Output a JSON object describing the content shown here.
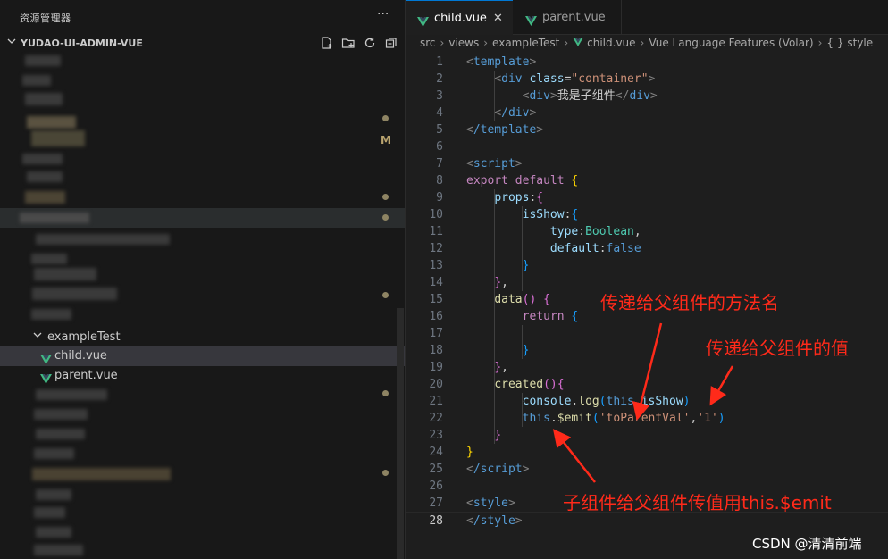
{
  "sidebar": {
    "title": "资源管理器",
    "more": "···",
    "project": "YUDAO-UI-ADMIN-VUE",
    "m_flag": "M",
    "folder": "exampleTest",
    "files": [
      "child.vue",
      "parent.vue"
    ]
  },
  "tabs": [
    {
      "label": "child.vue",
      "close": "✕"
    },
    {
      "label": "parent.vue"
    }
  ],
  "breadcrumb": [
    "src",
    "views",
    "exampleTest",
    "child.vue",
    "Vue Language Features (Volar)",
    "{ } style"
  ],
  "code": {
    "line_numbers": [
      "1",
      "2",
      "3",
      "4",
      "5",
      "6",
      "7",
      "8",
      "9",
      "10",
      "11",
      "12",
      "13",
      "14",
      "15",
      "16",
      "17",
      "18",
      "19",
      "20",
      "21",
      "22",
      "23",
      "24",
      "25",
      "26",
      "27",
      "28"
    ],
    "l1_tag": "template",
    "l2_tag": "div",
    "l2_attr": "class",
    "l2_eq": "=",
    "l2_val": "\"container\"",
    "l3_tag": "div",
    "l3_text": "我是子组件",
    "l4_tag": "/div",
    "l5_tag": "/template",
    "l7_tag": "script",
    "l8_kw1": "export",
    "l8_kw2": "default",
    "l9_prop": "props",
    "l10_prop": "isShow",
    "l11_prop": "type",
    "l11_type": "Boolean",
    "l12_prop": "default",
    "l12_val": "false",
    "l15_fn": "data",
    "l16_kw": "return",
    "l20_fn": "created",
    "l21_obj": "console",
    "l21_fn": "log",
    "l21_this": "this",
    "l21_prop": "isShow",
    "l22_this": "this",
    "l22_fn": "$emit",
    "l22_s1": "'toParentVal'",
    "l22_s2": "'1'",
    "l25_tag": "/script",
    "l27_tag": "style",
    "l28_tag": "/style"
  },
  "annotations": {
    "method_name": "传递给父组件的方法名",
    "value": "传递给父组件的值",
    "summary": "子组件给父组件传值用this.$emit"
  },
  "watermark": "CSDN @清清前端",
  "colors": {
    "annotation": "#ff2a1a",
    "vue_icon": "#41b883",
    "accent": "#0078d4"
  }
}
